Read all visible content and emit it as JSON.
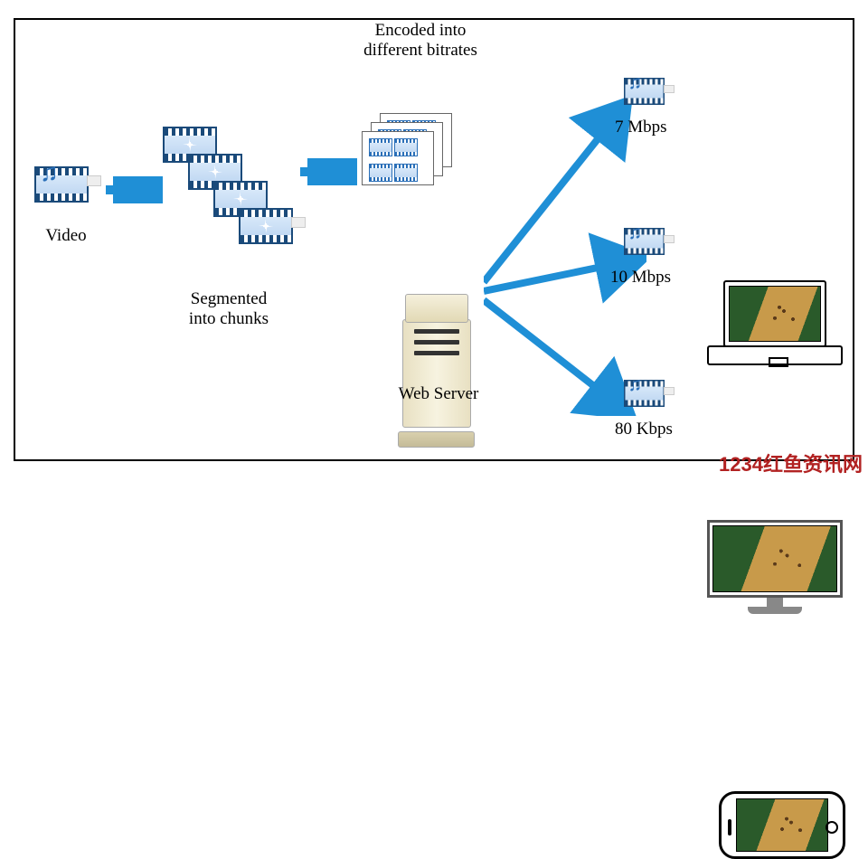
{
  "labels": {
    "video": "Video",
    "segmented_l1": "Segmented",
    "segmented_l2": "into chunks",
    "encoded_l1": "Encoded into",
    "encoded_l2": "different bitrates",
    "webserver": "Web Server",
    "rate_laptop": "7 Mbps",
    "rate_monitor": "10 Mbps",
    "rate_phone": "80 Kbps"
  },
  "watermark": "1234红鱼资讯网"
}
